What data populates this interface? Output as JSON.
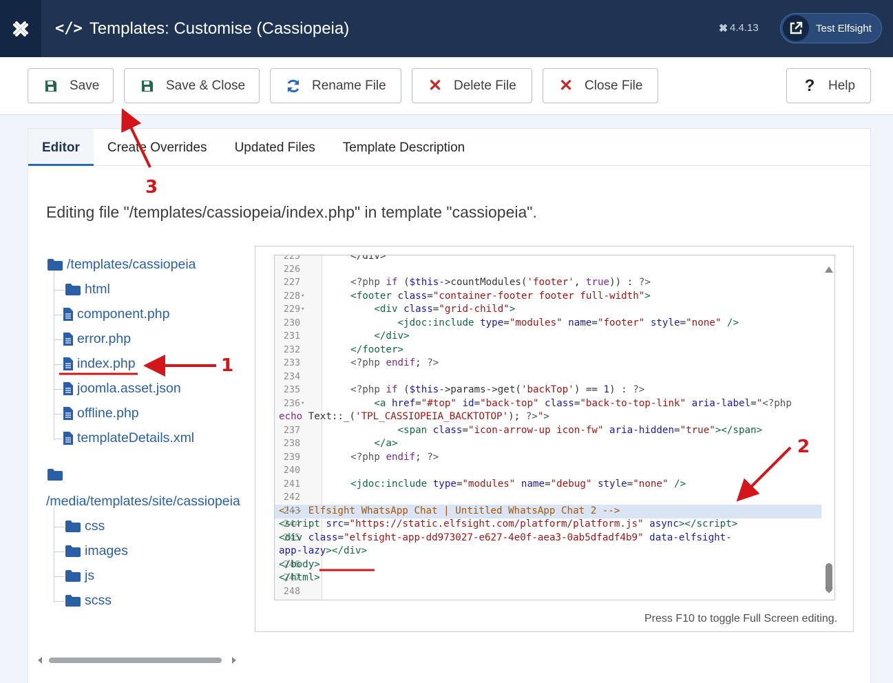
{
  "header": {
    "title": "Templates: Customise (Cassiopeia)",
    "version": "4.4.13",
    "user": "Test Elfsight",
    "logo_icon": "joomla-icon",
    "title_icon": "code-icon"
  },
  "toolbar": {
    "save": "Save",
    "save_close": "Save & Close",
    "rename": "Rename File",
    "delete": "Delete File",
    "close": "Close File",
    "help": "Help"
  },
  "tabs": [
    "Editor",
    "Create Overrides",
    "Updated Files",
    "Template Description"
  ],
  "editing_line": "Editing file \"/templates/cassiopeia/index.php\" in template \"cassiopeia\".",
  "tree": {
    "root1": "/templates/cassiopeia",
    "root1_items": [
      "html",
      "component.php",
      "error.php",
      "index.php",
      "joomla.asset.json",
      "offline.php",
      "templateDetails.xml"
    ],
    "root2": "/media/templates/site/cassiopeia",
    "root2_items": [
      "css",
      "images",
      "js",
      "scss"
    ]
  },
  "editor": {
    "line_numbers": [
      "226",
      "227",
      "228",
      "229",
      "230",
      "231",
      "232",
      "233",
      "234",
      "235",
      "236",
      "",
      "237",
      "238",
      "239",
      "240",
      "241",
      "242",
      "243",
      "244",
      "245",
      "",
      "246",
      "247",
      "248"
    ],
    "hint": "Press F10 to toggle Full Screen editing."
  },
  "annotations": [
    "1",
    "2",
    "3"
  ],
  "colors": {
    "header_bg": "#1f3352",
    "accent": "#2a69b8",
    "danger": "#c52827",
    "annotation": "#d4161b",
    "link": "#2a5fa8"
  }
}
